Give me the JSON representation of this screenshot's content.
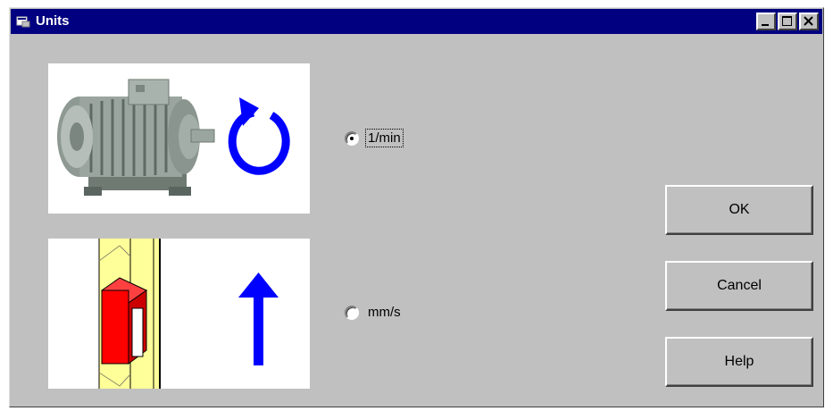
{
  "window": {
    "title": "Units",
    "icon": "app-window-icon",
    "controls": [
      "minimize-icon",
      "maximize-icon",
      "close-icon"
    ]
  },
  "images": {
    "rotation": "electric-motor-with-rotation-arrow",
    "linear": "elevator-shaft-with-up-arrow"
  },
  "options": {
    "rpm_label": "1/min",
    "rpm_selected": true,
    "mms_label": "mm/s",
    "mms_selected": false
  },
  "buttons": {
    "ok": "OK",
    "cancel": "Cancel",
    "help": "Help"
  },
  "colors": {
    "titlebar": "#000080",
    "face": "#c0c0c0",
    "arrow": "#0000ff",
    "car": "#ff0000",
    "shaft": "#ffff99"
  }
}
